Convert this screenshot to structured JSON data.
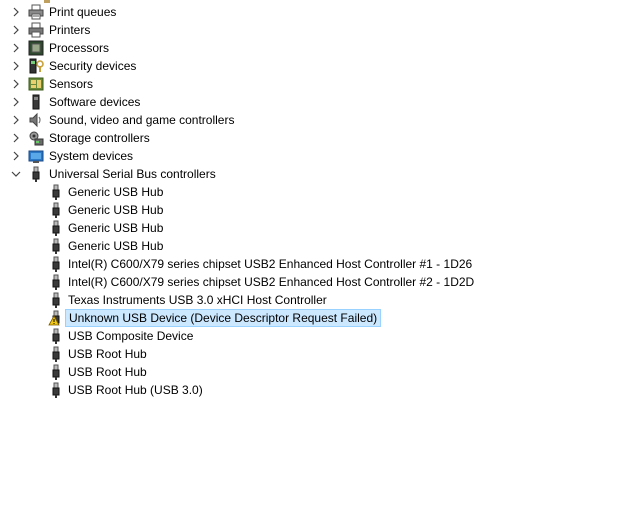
{
  "categories": [
    {
      "label": "Print queues",
      "icon": "print-queue-icon",
      "expanded": false
    },
    {
      "label": "Printers",
      "icon": "printer-icon",
      "expanded": false
    },
    {
      "label": "Processors",
      "icon": "processor-icon",
      "expanded": false
    },
    {
      "label": "Security devices",
      "icon": "security-device-icon",
      "expanded": false
    },
    {
      "label": "Sensors",
      "icon": "sensor-icon",
      "expanded": false
    },
    {
      "label": "Software devices",
      "icon": "software-device-icon",
      "expanded": false
    },
    {
      "label": "Sound, video and game controllers",
      "icon": "speaker-icon",
      "expanded": false
    },
    {
      "label": "Storage controllers",
      "icon": "storage-controller-icon",
      "expanded": false
    },
    {
      "label": "System devices",
      "icon": "system-device-icon",
      "expanded": false
    },
    {
      "label": "Universal Serial Bus controllers",
      "icon": "usb-plug-icon",
      "expanded": true
    }
  ],
  "usb_devices": [
    {
      "label": "Generic USB Hub",
      "icon": "usb-plug-icon"
    },
    {
      "label": "Generic USB Hub",
      "icon": "usb-plug-icon"
    },
    {
      "label": "Generic USB Hub",
      "icon": "usb-plug-icon"
    },
    {
      "label": "Generic USB Hub",
      "icon": "usb-plug-icon"
    },
    {
      "label": "Intel(R) C600/X79 series chipset USB2 Enhanced Host Controller #1 - 1D26",
      "icon": "usb-plug-icon"
    },
    {
      "label": "Intel(R) C600/X79 series chipset USB2 Enhanced Host Controller #2 - 1D2D",
      "icon": "usb-plug-icon"
    },
    {
      "label": "Texas Instruments USB 3.0 xHCI Host Controller",
      "icon": "usb-plug-icon"
    },
    {
      "label": "Unknown USB Device (Device Descriptor Request Failed)",
      "icon": "warning-usb-icon",
      "selected": true
    },
    {
      "label": "USB Composite Device",
      "icon": "usb-plug-icon"
    },
    {
      "label": "USB Root Hub",
      "icon": "usb-plug-icon"
    },
    {
      "label": "USB Root Hub",
      "icon": "usb-plug-icon"
    },
    {
      "label": "USB Root Hub (USB 3.0)",
      "icon": "usb-plug-icon"
    }
  ],
  "colors": {
    "selection_bg": "#cce8ff",
    "selection_border": "#99d1ff",
    "chevron": "#444444"
  }
}
